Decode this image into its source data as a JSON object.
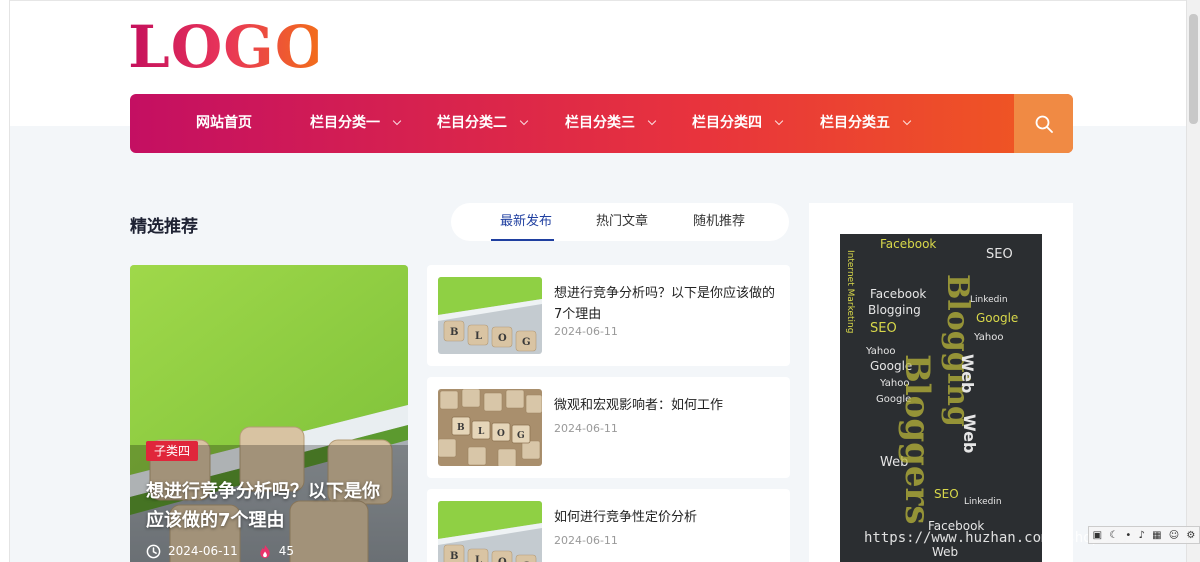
{
  "logo": {
    "text": "LOGO"
  },
  "nav": {
    "items": [
      {
        "label": "网站首页",
        "has_dropdown": false
      },
      {
        "label": "栏目分类一",
        "has_dropdown": true
      },
      {
        "label": "栏目分类二",
        "has_dropdown": true
      },
      {
        "label": "栏目分类三",
        "has_dropdown": true
      },
      {
        "label": "栏目分类四",
        "has_dropdown": true
      },
      {
        "label": "栏目分类五",
        "has_dropdown": true
      }
    ],
    "search_icon": "search-icon"
  },
  "section": {
    "title": "精选推荐",
    "tabs": [
      {
        "label": "最新发布",
        "active": true
      },
      {
        "label": "热门文章",
        "active": false
      },
      {
        "label": "随机推荐",
        "active": false
      }
    ]
  },
  "featured": {
    "badge": "子类四",
    "title": "想进行竞争分析吗？以下是你应该做的7个理由",
    "date": "2024-06-11",
    "count": "45"
  },
  "posts": [
    {
      "title": "想进行竞争分析吗？以下是你应该做的7个理由",
      "date": "2024-06-11"
    },
    {
      "title": "微观和宏观影响者：如何工作",
      "date": "2024-06-11"
    },
    {
      "title": "如何进行竞争性定价分析",
      "date": "2024-06-11"
    }
  ],
  "watermark": "https://www.huzhan.com/ishop34055",
  "colors": {
    "nav_start": "#c40f62",
    "nav_end": "#f05a20",
    "search_bg": "#f08a44",
    "accent_blue": "#1f3fa0",
    "badge": "#e0263b"
  }
}
